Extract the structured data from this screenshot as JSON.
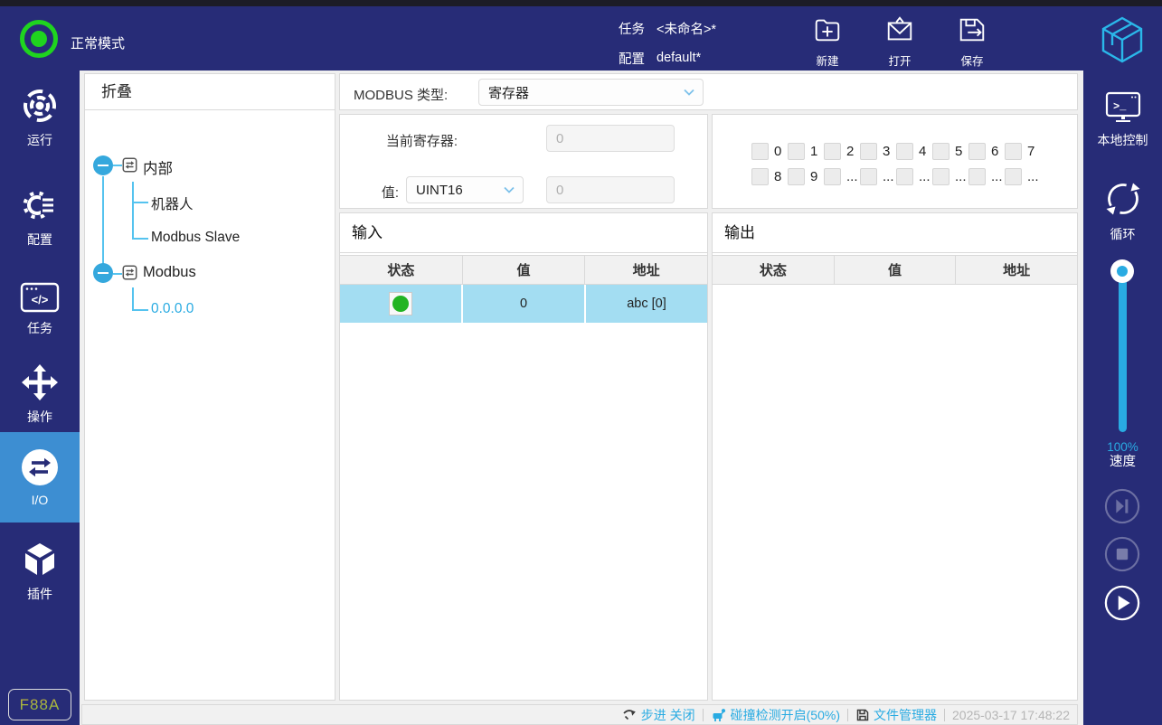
{
  "topbar": {
    "mode": "正常模式",
    "task_label": "任务",
    "task_value": "<未命名>*",
    "config_label": "配置",
    "config_value": "default*",
    "new_label": "新建",
    "open_label": "打开",
    "save_label": "保存"
  },
  "sidebar_left": {
    "items": [
      {
        "label": "运行"
      },
      {
        "label": "配置"
      },
      {
        "label": "任务"
      },
      {
        "label": "操作"
      },
      {
        "label": "I/O",
        "selected": true
      },
      {
        "label": "插件"
      }
    ],
    "badge": "F88A"
  },
  "tree": {
    "header": "折叠",
    "node1": "内部",
    "node1_child1": "机器人",
    "node1_child2": "Modbus Slave",
    "node2": "Modbus",
    "node2_child1": "0.0.0.0"
  },
  "modbus": {
    "type_label": "MODBUS 类型:",
    "type_value": "寄存器",
    "register_label": "当前寄存器:",
    "register_value": "0",
    "value_label": "值:",
    "value_type": "UINT16",
    "value": "0"
  },
  "bits": [
    "0",
    "1",
    "2",
    "3",
    "4",
    "5",
    "6",
    "7",
    "8",
    "9",
    "...",
    "...",
    "...",
    "...",
    "...",
    "..."
  ],
  "io_input": {
    "title": "输入",
    "columns": [
      "状态",
      "值",
      "地址"
    ],
    "row": {
      "status": "on",
      "value": "0",
      "address": "abc [0]"
    }
  },
  "io_output": {
    "title": "输出",
    "columns": [
      "状态",
      "值",
      "地址"
    ]
  },
  "sidebar_right": {
    "local_control": "本地控制",
    "loop": "循环",
    "speed_value": "100%",
    "speed_label": "速度"
  },
  "statusbar": {
    "step": "步进 关闭",
    "collision": "碰撞检测开启(50%)",
    "file_manager": "文件管理器",
    "timestamp": "2025-03-17 17:48:22"
  },
  "icons": {
    "task_glyph": "</>",
    "terminal_glyph": ">_"
  },
  "colors": {
    "navy": "#272c77",
    "accent": "#29abe2",
    "selected_item": "#3d8ed2",
    "row_highlight": "#a3ddf2",
    "status_green": "#22b422",
    "mode_green": "#1fd41f",
    "badge_gradient_top": "#d9a93c",
    "badge_gradient_bottom": "#7ec83e"
  }
}
